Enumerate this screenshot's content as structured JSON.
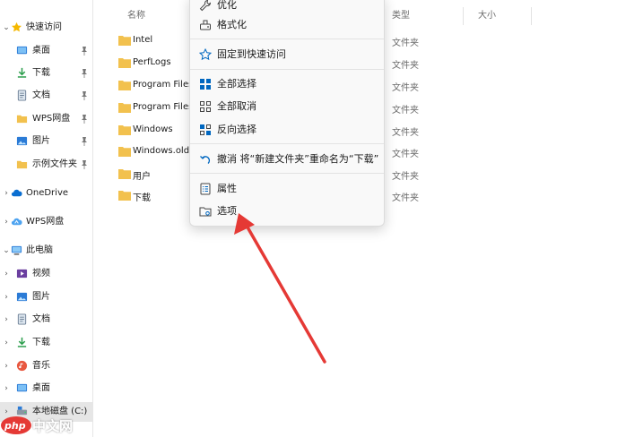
{
  "sidebar": {
    "items": [
      {
        "label": "快速访问",
        "icon": "star-icon",
        "chevron": "expanded",
        "pinned": false
      },
      {
        "label": "桌面",
        "icon": "desktop-icon",
        "pinned": true
      },
      {
        "label": "下载",
        "icon": "download-icon",
        "pinned": true
      },
      {
        "label": "文档",
        "icon": "document-icon",
        "pinned": true
      },
      {
        "label": "WPS网盘",
        "icon": "folder-icon",
        "pinned": true
      },
      {
        "label": "图片",
        "icon": "picture-icon",
        "pinned": true
      },
      {
        "label": "示例文件夹",
        "icon": "folder-icon",
        "pinned": true
      },
      {
        "label": "OneDrive",
        "icon": "cloud-icon",
        "chevron": "collapsed"
      },
      {
        "label": "WPS网盘",
        "icon": "wps-cloud-icon",
        "chevron": "collapsed"
      },
      {
        "label": "此电脑",
        "icon": "computer-icon",
        "chevron": "expanded"
      },
      {
        "label": "视频",
        "icon": "video-icon",
        "chevron": "collapsed"
      },
      {
        "label": "图片",
        "icon": "picture-icon",
        "chevron": "collapsed"
      },
      {
        "label": "文档",
        "icon": "document-icon",
        "chevron": "collapsed"
      },
      {
        "label": "下载",
        "icon": "download-icon",
        "chevron": "collapsed"
      },
      {
        "label": "音乐",
        "icon": "music-icon",
        "chevron": "collapsed"
      },
      {
        "label": "桌面",
        "icon": "desktop-icon",
        "chevron": "collapsed"
      },
      {
        "label": "本地磁盘 (C:)",
        "icon": "drive-icon",
        "chevron": "collapsed",
        "selected": true
      }
    ]
  },
  "columns": {
    "name": "名称",
    "type": "类型",
    "size": "大小"
  },
  "files": [
    {
      "name": "Intel",
      "type": "文件夹"
    },
    {
      "name": "PerfLogs",
      "type": "文件夹"
    },
    {
      "name": "Program Files",
      "type": "文件夹"
    },
    {
      "name": "Program Files",
      "type": "文件夹"
    },
    {
      "name": "Windows",
      "type": "文件夹"
    },
    {
      "name": "Windows.old",
      "type": "文件夹"
    },
    {
      "name": "用户",
      "type": "文件夹"
    },
    {
      "name": "下载",
      "type": "文件夹"
    }
  ],
  "context_menu": {
    "items": [
      {
        "label": "优化",
        "icon": "wrench-icon"
      },
      {
        "label": "格式化",
        "icon": "format-icon"
      },
      {
        "label": "固定到快速访问",
        "icon": "pin-star-icon"
      },
      {
        "label": "全部选择",
        "icon": "select-all-icon"
      },
      {
        "label": "全部取消",
        "icon": "select-none-icon"
      },
      {
        "label": "反向选择",
        "icon": "invert-selection-icon"
      },
      {
        "label": "撤消 将“新建文件夹”重命名为“下载”",
        "icon": "undo-icon"
      },
      {
        "label": "属性",
        "icon": "properties-icon"
      },
      {
        "label": "选项",
        "icon": "options-icon"
      }
    ]
  },
  "annotation": {
    "color": "#e53935"
  },
  "watermark": {
    "text": "中文网",
    "logo": "php"
  },
  "colors": {
    "folder": "#f2c14e",
    "accent": "#0067c0",
    "selected": "#e6e6e6"
  }
}
